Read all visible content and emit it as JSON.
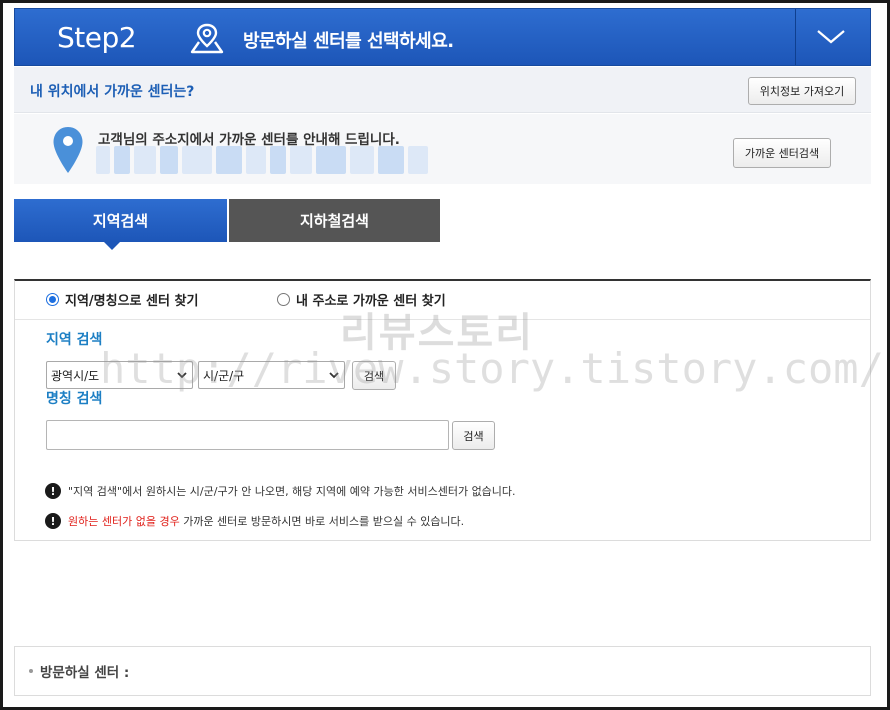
{
  "header": {
    "step_label": "Step2",
    "title": "방문하실 센터를 선택하세요."
  },
  "location": {
    "title": "내 위치에서 가까운 센터는?",
    "get_location_button": "위치정보 가져오기",
    "address_notice": "고객님의 주소지에서 가까운 센터를 안내해 드립니다.",
    "nearby_search_button": "가까운 센터검색"
  },
  "tabs": [
    {
      "label": "지역검색",
      "active": true
    },
    {
      "label": "지하철검색",
      "active": false
    }
  ],
  "search": {
    "radio_options": [
      {
        "label": "지역/명칭으로 센터 찾기",
        "checked": true
      },
      {
        "label": "내 주소로 가까운 센터 찾기",
        "checked": false
      }
    ],
    "region_label": "지역 검색",
    "province_select": "광역시/도",
    "city_select": "시/군/구",
    "region_search_button": "검색",
    "name_label": "명칭 검색",
    "name_input_value": "",
    "name_search_button": "검색",
    "notice1": "\"지역 검색\"에서 원하시는 시/군/구가 안 나오면, 해당 지역에 예약 가능한 서비스센터가 없습니다.",
    "notice2_red": "원하는 센터가 없을 경우",
    "notice2_rest": " 가까운 센터로 방문하시면 바로 서비스를 받으실 수 있습니다."
  },
  "center": {
    "label": "방문하실 센터 :"
  },
  "watermark": {
    "line1": "리뷰스토리",
    "line2": "http://rivew.story.tistory.com/"
  },
  "colors": {
    "brand_blue": "#1d56b8",
    "tab_inactive": "#555555",
    "label_blue": "#1d7fc4",
    "alert_red": "#e0201a"
  },
  "icons": [
    "location-pin-icon",
    "chevron-down-icon",
    "map-pin-icon",
    "exclamation-icon"
  ]
}
